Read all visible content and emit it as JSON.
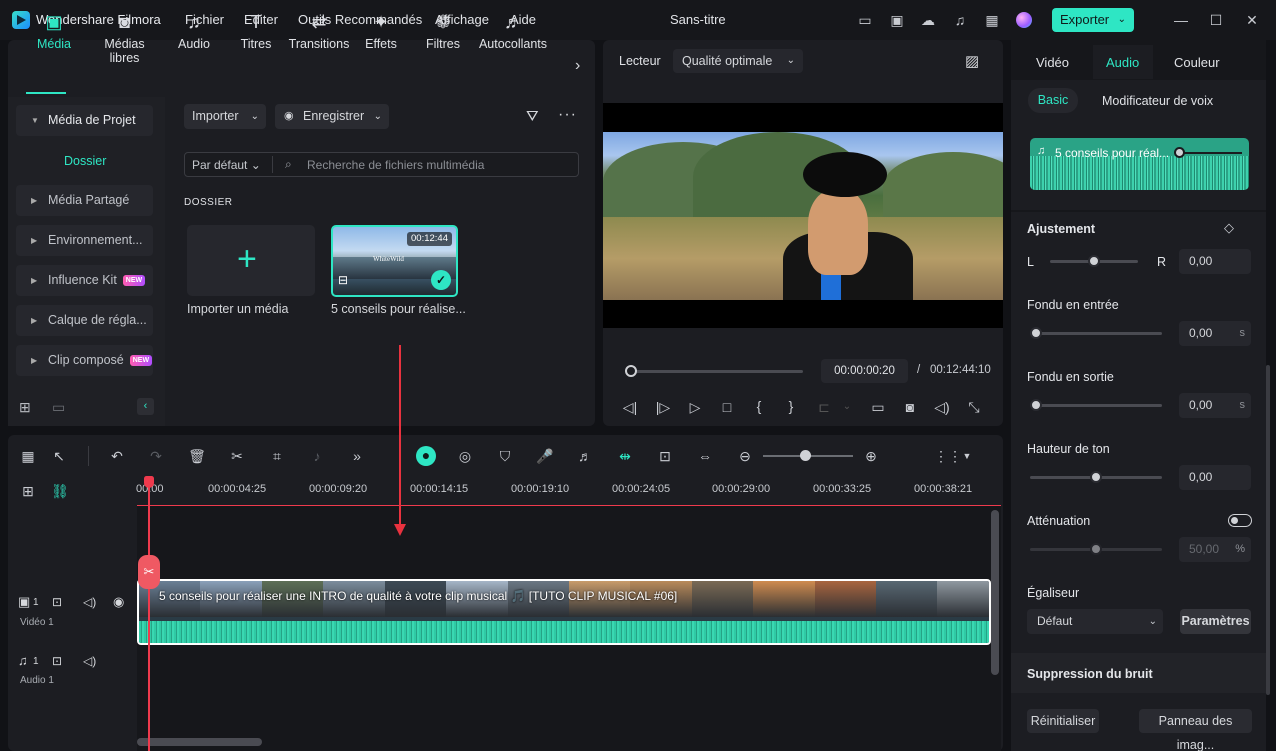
{
  "titlebar": {
    "app_name": "Wondershare Filmora",
    "menus": [
      "Fichier",
      "Editer",
      "Outils Recommandés",
      "Affichage",
      "Aide"
    ],
    "project_title": "Sans-titre",
    "export_label": "Exporter"
  },
  "media_tabs": [
    {
      "label": "Média",
      "icon": "media-icon"
    },
    {
      "label": "Médias libres",
      "icon": "stock-media-icon"
    },
    {
      "label": "Audio",
      "icon": "music-note-icon"
    },
    {
      "label": "Titres",
      "icon": "text-icon"
    },
    {
      "label": "Transitions",
      "icon": "transitions-icon"
    },
    {
      "label": "Effets",
      "icon": "effects-icon"
    },
    {
      "label": "Filtres",
      "icon": "filters-icon"
    },
    {
      "label": "Autocollants",
      "icon": "stickers-icon"
    }
  ],
  "media_sidebar": {
    "project_media": "Média de Projet",
    "folder": "Dossier",
    "items": [
      {
        "label": "Média Partagé",
        "new": false
      },
      {
        "label": "Environnement...",
        "new": false
      },
      {
        "label": "Influence Kit",
        "new": true
      },
      {
        "label": "Calque de régla...",
        "new": false
      },
      {
        "label": "Clip composé",
        "new": true
      }
    ],
    "new_badge": "NEW"
  },
  "media_toolbar": {
    "import_label": "Importer",
    "record_label": "Enregistrer",
    "sort_label": "Par défaut",
    "search_placeholder": "Recherche de fichiers multimédia",
    "folder_heading": "DOSSIER"
  },
  "media_items": {
    "import_label": "Importer un média",
    "clip_label": "5 conseils pour réalise...",
    "clip_duration": "00:12:44",
    "clip_watermark": "WhiteWild"
  },
  "preview": {
    "label": "Lecteur",
    "quality": "Qualité optimale",
    "current_time": "00:00:00:20",
    "separator": "/",
    "total_time": "00:12:44:10",
    "progress": 0.001
  },
  "timeline": {
    "ruler": [
      "00:00",
      "00:00:04:25",
      "00:00:09:20",
      "00:00:14:15",
      "00:00:19:10",
      "00:00:24:05",
      "00:00:29:00",
      "00:00:33:25",
      "00:00:38:21"
    ],
    "clip_title": "5 conseils pour réaliser une INTRO de qualité à votre clip musical 🎵 [TUTO CLIP MUSICAL #06]",
    "video_track": {
      "num": "1",
      "name": "Vidéo 1"
    },
    "audio_track": {
      "num": "1",
      "name": "Audio 1"
    }
  },
  "right_panel": {
    "tabs": [
      "Vidéo",
      "Audio",
      "Couleur"
    ],
    "active_tab": "Audio",
    "subtabs": [
      "Basic",
      "Modificateur de voix"
    ],
    "clip_name": "5 conseils pour réal...",
    "adjust_label": "Ajustement",
    "balance": {
      "left": "L",
      "right": "R",
      "value": "0,00",
      "level": 0.5
    },
    "fade_in": {
      "label": "Fondu en entrée",
      "value": "0,00",
      "unit": "s",
      "level": 0.0
    },
    "fade_out": {
      "label": "Fondu en sortie",
      "value": "0,00",
      "unit": "s",
      "level": 0.0
    },
    "pitch": {
      "label": "Hauteur de ton",
      "value": "0,00",
      "level": 0.5
    },
    "ducking": {
      "label": "Atténuation",
      "value": "50,00",
      "unit": "%",
      "level": 0.5,
      "enabled": false
    },
    "equalizer": {
      "label": "Égaliseur",
      "preset": "Défaut",
      "settings_label": "Paramètres"
    },
    "noise_label": "Suppression du bruit",
    "reset_label": "Réinitialiser",
    "panel_label": "Panneau des imag..."
  },
  "colors": {
    "accent": "#2ee6c4",
    "playhead": "#ef3a4d",
    "new_badge": "#ff5db1"
  }
}
